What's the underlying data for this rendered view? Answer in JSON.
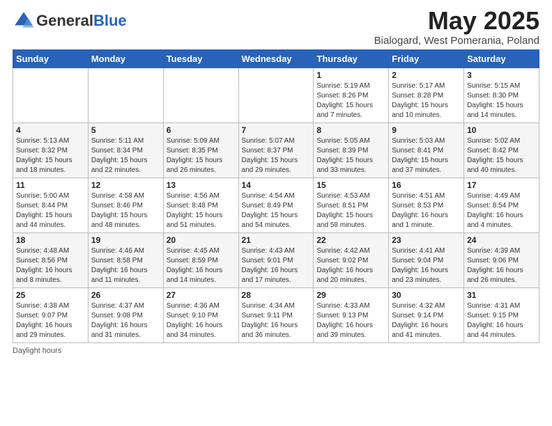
{
  "header": {
    "logo_general": "General",
    "logo_blue": "Blue",
    "month_title": "May 2025",
    "location": "Bialogard, West Pomerania, Poland"
  },
  "weekdays": [
    "Sunday",
    "Monday",
    "Tuesday",
    "Wednesday",
    "Thursday",
    "Friday",
    "Saturday"
  ],
  "weeks": [
    [
      {
        "day": "",
        "info": ""
      },
      {
        "day": "",
        "info": ""
      },
      {
        "day": "",
        "info": ""
      },
      {
        "day": "",
        "info": ""
      },
      {
        "day": "1",
        "info": "Sunrise: 5:19 AM\nSunset: 8:26 PM\nDaylight: 15 hours and 7 minutes."
      },
      {
        "day": "2",
        "info": "Sunrise: 5:17 AM\nSunset: 8:28 PM\nDaylight: 15 hours and 10 minutes."
      },
      {
        "day": "3",
        "info": "Sunrise: 5:15 AM\nSunset: 8:30 PM\nDaylight: 15 hours and 14 minutes."
      }
    ],
    [
      {
        "day": "4",
        "info": "Sunrise: 5:13 AM\nSunset: 8:32 PM\nDaylight: 15 hours and 18 minutes."
      },
      {
        "day": "5",
        "info": "Sunrise: 5:11 AM\nSunset: 8:34 PM\nDaylight: 15 hours and 22 minutes."
      },
      {
        "day": "6",
        "info": "Sunrise: 5:09 AM\nSunset: 8:35 PM\nDaylight: 15 hours and 26 minutes."
      },
      {
        "day": "7",
        "info": "Sunrise: 5:07 AM\nSunset: 8:37 PM\nDaylight: 15 hours and 29 minutes."
      },
      {
        "day": "8",
        "info": "Sunrise: 5:05 AM\nSunset: 8:39 PM\nDaylight: 15 hours and 33 minutes."
      },
      {
        "day": "9",
        "info": "Sunrise: 5:03 AM\nSunset: 8:41 PM\nDaylight: 15 hours and 37 minutes."
      },
      {
        "day": "10",
        "info": "Sunrise: 5:02 AM\nSunset: 8:42 PM\nDaylight: 15 hours and 40 minutes."
      }
    ],
    [
      {
        "day": "11",
        "info": "Sunrise: 5:00 AM\nSunset: 8:44 PM\nDaylight: 15 hours and 44 minutes."
      },
      {
        "day": "12",
        "info": "Sunrise: 4:58 AM\nSunset: 8:46 PM\nDaylight: 15 hours and 48 minutes."
      },
      {
        "day": "13",
        "info": "Sunrise: 4:56 AM\nSunset: 8:48 PM\nDaylight: 15 hours and 51 minutes."
      },
      {
        "day": "14",
        "info": "Sunrise: 4:54 AM\nSunset: 8:49 PM\nDaylight: 15 hours and 54 minutes."
      },
      {
        "day": "15",
        "info": "Sunrise: 4:53 AM\nSunset: 8:51 PM\nDaylight: 15 hours and 58 minutes."
      },
      {
        "day": "16",
        "info": "Sunrise: 4:51 AM\nSunset: 8:53 PM\nDaylight: 16 hours and 1 minute."
      },
      {
        "day": "17",
        "info": "Sunrise: 4:49 AM\nSunset: 8:54 PM\nDaylight: 16 hours and 4 minutes."
      }
    ],
    [
      {
        "day": "18",
        "info": "Sunrise: 4:48 AM\nSunset: 8:56 PM\nDaylight: 16 hours and 8 minutes."
      },
      {
        "day": "19",
        "info": "Sunrise: 4:46 AM\nSunset: 8:58 PM\nDaylight: 16 hours and 11 minutes."
      },
      {
        "day": "20",
        "info": "Sunrise: 4:45 AM\nSunset: 8:59 PM\nDaylight: 16 hours and 14 minutes."
      },
      {
        "day": "21",
        "info": "Sunrise: 4:43 AM\nSunset: 9:01 PM\nDaylight: 16 hours and 17 minutes."
      },
      {
        "day": "22",
        "info": "Sunrise: 4:42 AM\nSunset: 9:02 PM\nDaylight: 16 hours and 20 minutes."
      },
      {
        "day": "23",
        "info": "Sunrise: 4:41 AM\nSunset: 9:04 PM\nDaylight: 16 hours and 23 minutes."
      },
      {
        "day": "24",
        "info": "Sunrise: 4:39 AM\nSunset: 9:06 PM\nDaylight: 16 hours and 26 minutes."
      }
    ],
    [
      {
        "day": "25",
        "info": "Sunrise: 4:38 AM\nSunset: 9:07 PM\nDaylight: 16 hours and 29 minutes."
      },
      {
        "day": "26",
        "info": "Sunrise: 4:37 AM\nSunset: 9:08 PM\nDaylight: 16 hours and 31 minutes."
      },
      {
        "day": "27",
        "info": "Sunrise: 4:36 AM\nSunset: 9:10 PM\nDaylight: 16 hours and 34 minutes."
      },
      {
        "day": "28",
        "info": "Sunrise: 4:34 AM\nSunset: 9:11 PM\nDaylight: 16 hours and 36 minutes."
      },
      {
        "day": "29",
        "info": "Sunrise: 4:33 AM\nSunset: 9:13 PM\nDaylight: 16 hours and 39 minutes."
      },
      {
        "day": "30",
        "info": "Sunrise: 4:32 AM\nSunset: 9:14 PM\nDaylight: 16 hours and 41 minutes."
      },
      {
        "day": "31",
        "info": "Sunrise: 4:31 AM\nSunset: 9:15 PM\nDaylight: 16 hours and 44 minutes."
      }
    ]
  ],
  "footer": "Daylight hours"
}
